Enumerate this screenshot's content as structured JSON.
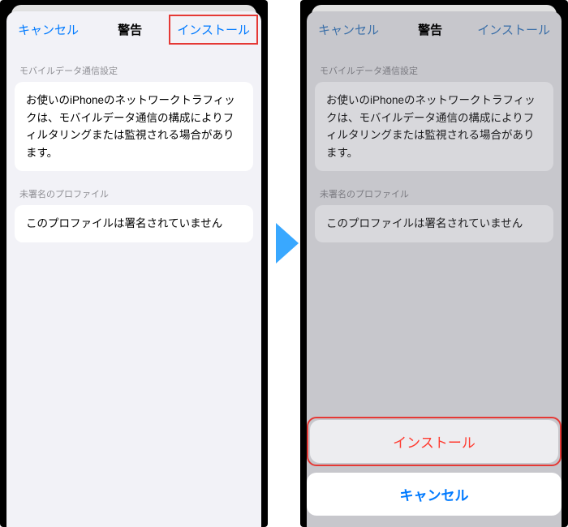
{
  "left": {
    "nav": {
      "cancel": "キャンセル",
      "title": "警告",
      "install": "インストール"
    },
    "section1": {
      "header": "モバイルデータ通信設定",
      "body": "お使いのiPhoneのネットワークトラフィックは、モバイルデータ通信の構成によりフィルタリングまたは監視される場合があります。"
    },
    "section2": {
      "header": "未署名のプロファイル",
      "body": "このプロファイルは署名されていません"
    }
  },
  "right": {
    "nav": {
      "cancel": "キャンセル",
      "title": "警告",
      "install": "インストール"
    },
    "section1": {
      "header": "モバイルデータ通信設定",
      "body": "お使いのiPhoneのネットワークトラフィックは、モバイルデータ通信の構成によりフィルタリングまたは監視される場合があります。"
    },
    "section2": {
      "header": "未署名のプロファイル",
      "body": "このプロファイルは署名されていません"
    },
    "actions": {
      "install": "インストール",
      "cancel": "キャンセル"
    }
  }
}
